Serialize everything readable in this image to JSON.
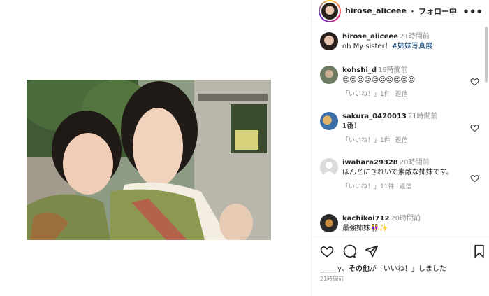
{
  "post": {
    "username": "hirose_aliceee",
    "separator": "・",
    "follow_label": "フォロー中",
    "caption_time": "21時間前",
    "caption_text": "oh My sister！",
    "caption_hashtag": "#姉妹写真展"
  },
  "comments": [
    {
      "user": "kohshi_d",
      "time": "19時間前",
      "text": "😍😍😍😍😍😍😍😍😍😍",
      "likes": "「いいね！」1件",
      "reply": "返信"
    },
    {
      "user": "sakura_0420013",
      "time": "21時間前",
      "text": "1番！",
      "likes": "「いいね！」1件",
      "reply": "返信"
    },
    {
      "user": "iwahara29328",
      "time": "20時間前",
      "text": "ほんとにきれいで素敵な姉妹です。",
      "likes": "「いいね！」11件",
      "reply": "返信"
    },
    {
      "user": "kachikoi712",
      "time": "20時間前",
      "text": "最強姉妹👭✨"
    }
  ],
  "likes_line": {
    "user": "_____y",
    "sep": "、",
    "others": "その他",
    "suffix": "が「いいね！」しました"
  },
  "post_time": "21時間前",
  "icons": [
    "heart-icon",
    "comment-icon",
    "share-icon",
    "bookmark-icon",
    "more-icon"
  ]
}
